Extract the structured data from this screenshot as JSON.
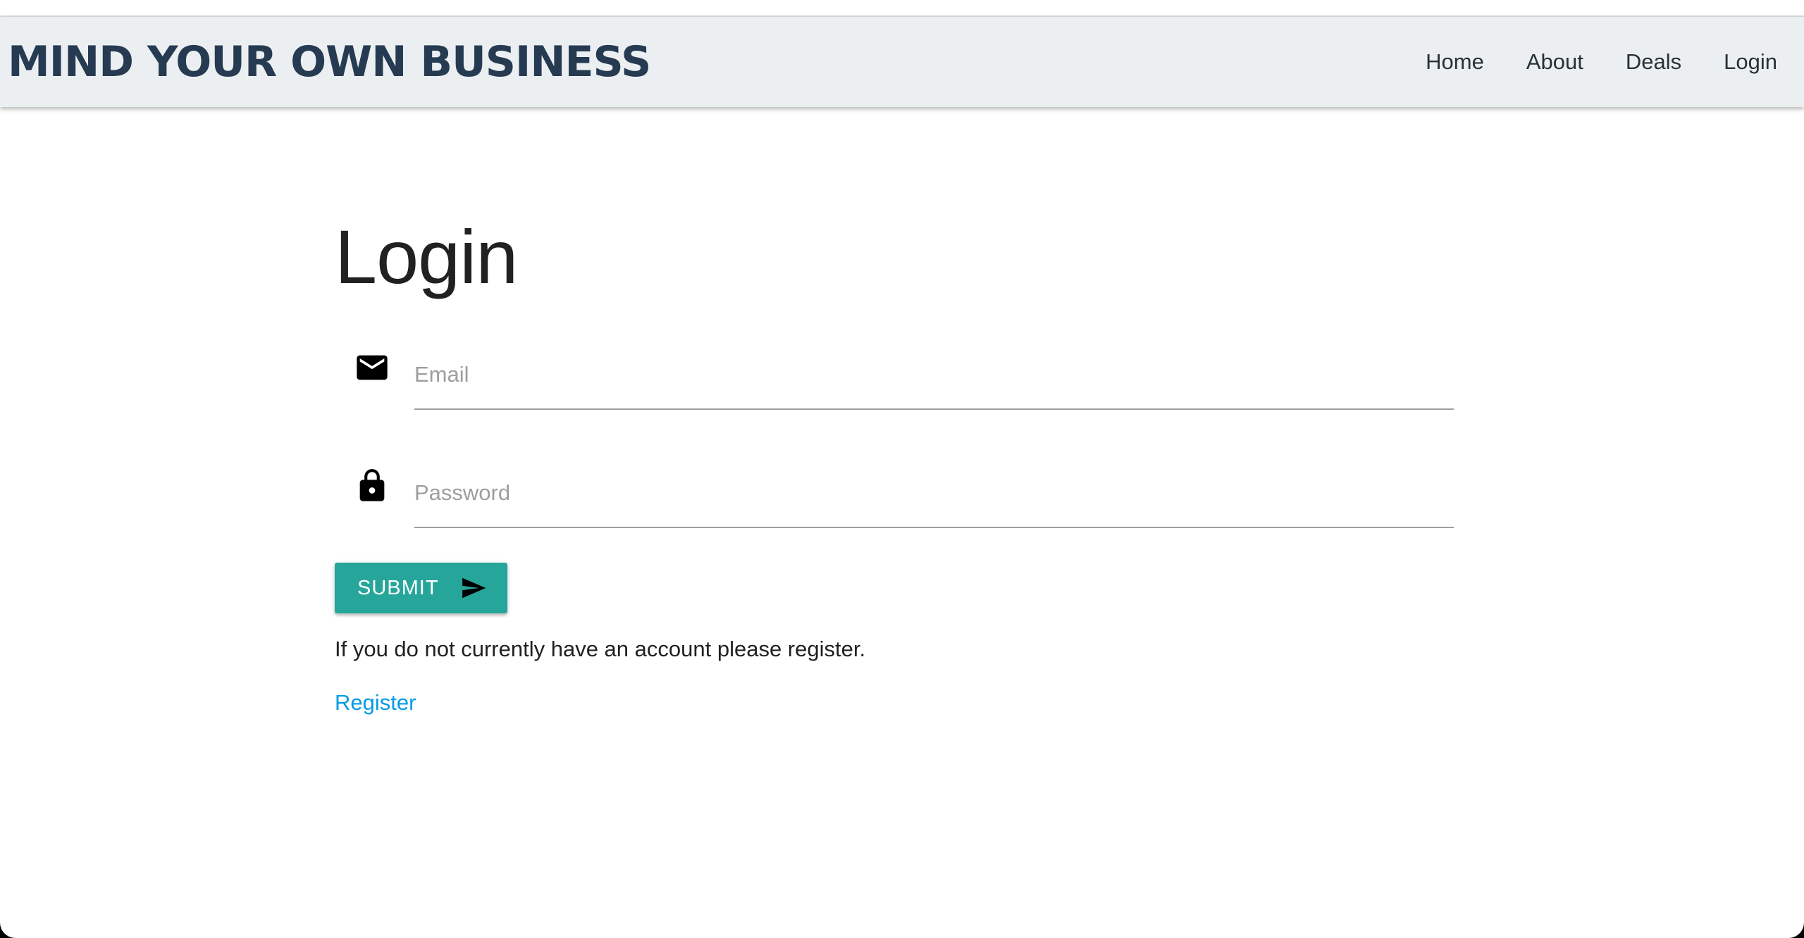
{
  "header": {
    "brand": "MIND YOUR OWN BUSINESS",
    "nav": [
      {
        "label": "Home"
      },
      {
        "label": "About"
      },
      {
        "label": "Deals"
      },
      {
        "label": "Login"
      }
    ]
  },
  "main": {
    "title": "Login",
    "email": {
      "placeholder": "Email",
      "value": "",
      "icon": "mail-icon"
    },
    "password": {
      "placeholder": "Password",
      "value": "",
      "icon": "lock-icon"
    },
    "submit": {
      "label": "SUBMIT",
      "icon": "send-icon"
    },
    "register_note": "If you do not currently have an account please register.",
    "register_link": "Register"
  },
  "colors": {
    "navbar_bg": "#eceff1",
    "brand_text": "#263b52",
    "button_bg": "#26a69a",
    "link": "#039be5"
  }
}
